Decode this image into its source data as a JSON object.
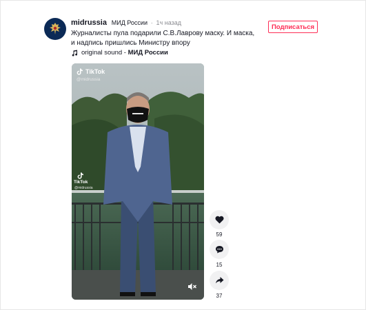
{
  "post": {
    "username": "midrussia",
    "nickname": "МИД России",
    "separator": "·",
    "time": "1ч назад",
    "caption": "Журналисты пула подарили С.В.Лаврову маску. И маска, и надпись пришлись Министру впору",
    "music_label": "original sound",
    "music_separator": " - ",
    "music_author": "МИД России",
    "follow_label": "Подписаться"
  },
  "video": {
    "watermark_brand": "TikTok",
    "watermark_handle": "@midrussia",
    "watermark_mid_brand": "TikTok",
    "watermark_mid_handle": "@midrussia"
  },
  "actions": {
    "likes": "59",
    "comments": "15",
    "shares": "37"
  },
  "colors": {
    "accent": "#fe2c55",
    "text": "#161823",
    "muted": "#8a8b91",
    "action_bg": "#f1f1f2"
  },
  "icons": [
    "music-note-icon",
    "heart-icon",
    "comment-icon",
    "share-icon",
    "mute-icon",
    "tiktok-logo-icon",
    "emblem-icon"
  ]
}
